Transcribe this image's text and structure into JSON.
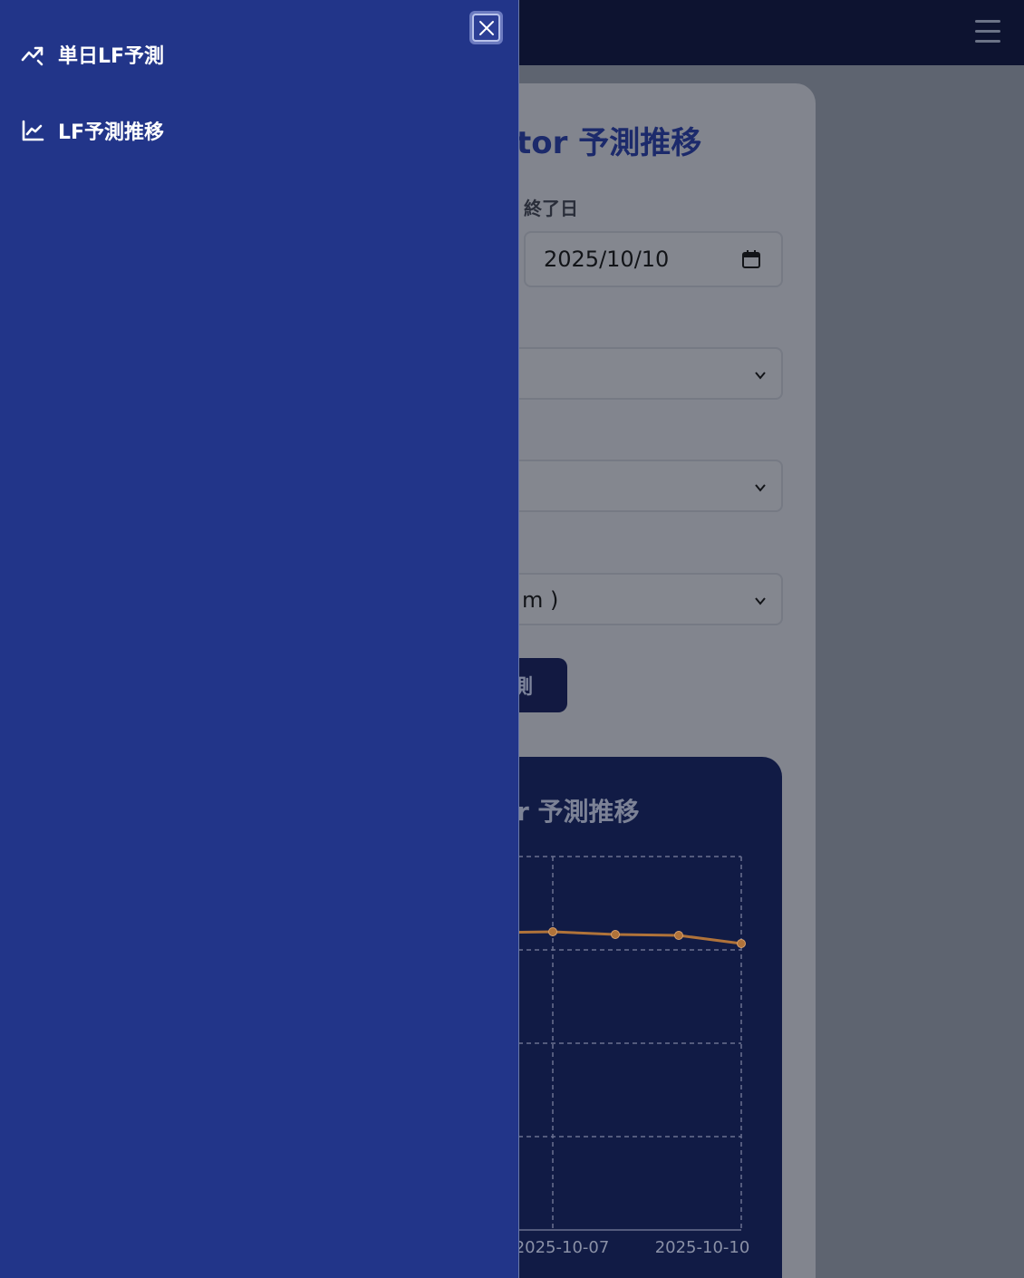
{
  "underlying": {
    "title": "tor 予測推移",
    "end_date_label": "終了日",
    "end_date_value": "2025/10/10",
    "select3_partial_value": "m )",
    "run_button_partial": "測",
    "chart_title": "r 予測推移"
  },
  "drawer": {
    "items": [
      {
        "label": "単日LF予測",
        "icon": "trending-up-icon"
      },
      {
        "label": "LF予測推移",
        "icon": "line-chart-icon"
      }
    ],
    "close_icon": "close-icon"
  },
  "chart_data": {
    "type": "line",
    "x": [
      "2025-10-07",
      "2025-10-08",
      "2025-10-09",
      "2025-10-10"
    ],
    "x_tick_labels_visible": [
      "2025-10-07",
      "2025-10-10"
    ],
    "series": [
      {
        "color": "#b0733a"
      }
    ],
    "grid": true,
    "colors": {
      "line": "#b0733a",
      "grid": "#6a7190",
      "tick": "#8a90a6"
    }
  },
  "colors": {
    "drawer_bg": "#223589",
    "topbar_bg": "#0d1330",
    "chart_bg": "#111b45",
    "accent_title": "#1c2a6b"
  }
}
